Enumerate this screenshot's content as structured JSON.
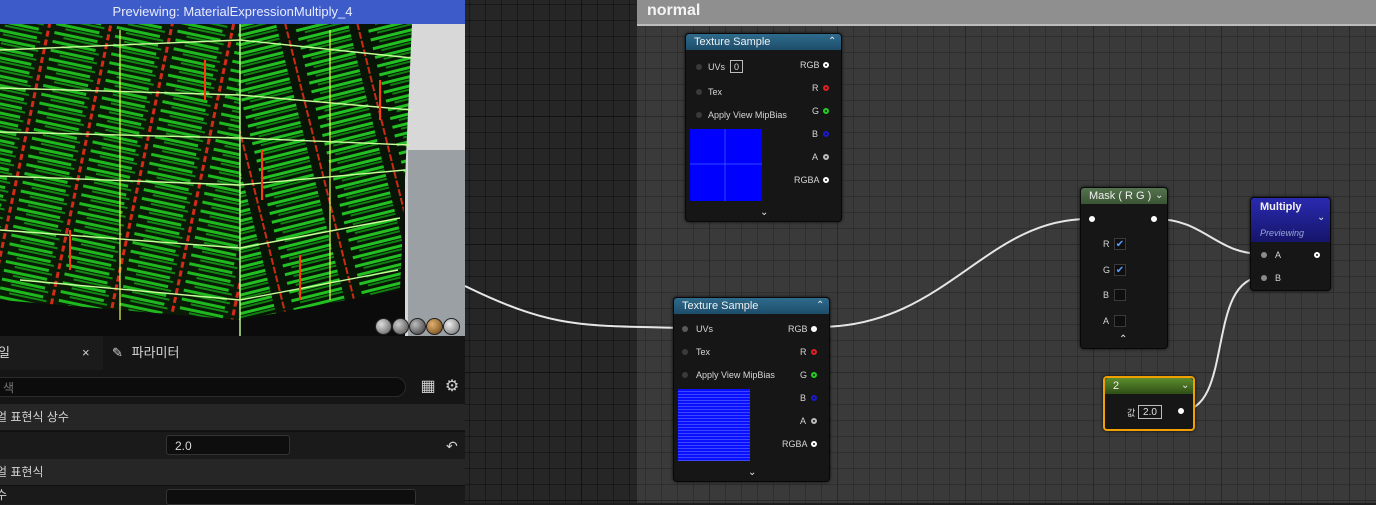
{
  "preview": {
    "title": "Previewing: MaterialExpressionMultiply_4",
    "viewport_icons": [
      "sphere-preview-icon",
      "cylinder-preview-icon",
      "plane-preview-icon",
      "cube-preview-icon",
      "teapot-preview-icon"
    ]
  },
  "details": {
    "tabs": [
      {
        "label": "일",
        "close": "×"
      },
      {
        "label": "파라미터"
      }
    ],
    "search_placeholder": "색",
    "categories": [
      {
        "label": "얼 표현식 상수"
      },
      {
        "label": "얼 표현식"
      }
    ],
    "rows": [
      {
        "label": "",
        "value": "2.0",
        "reset": "↶"
      },
      {
        "label": "수",
        "value": ""
      }
    ]
  },
  "graph": {
    "comment": "normal",
    "nodes": {
      "texture_sample_1": {
        "title": "Texture Sample",
        "inputs": [
          "UVs",
          "Tex",
          "Apply View MipBias"
        ],
        "uv_value": "0",
        "outputs": [
          "RGB",
          "R",
          "G",
          "B",
          "A",
          "RGBA"
        ]
      },
      "texture_sample_2": {
        "title": "Texture Sample",
        "inputs": [
          "UVs",
          "Tex",
          "Apply View MipBias"
        ],
        "outputs": [
          "RGB",
          "R",
          "G",
          "B",
          "A",
          "RGBA"
        ]
      },
      "mask": {
        "title": "Mask ( R G )",
        "channels": [
          {
            "label": "R",
            "checked": true
          },
          {
            "label": "G",
            "checked": true
          },
          {
            "label": "B",
            "checked": false
          },
          {
            "label": "A",
            "checked": false
          }
        ]
      },
      "multiply": {
        "title": "Multiply",
        "subtitle": "Previewing",
        "inputs": [
          "A",
          "B"
        ]
      },
      "constant": {
        "title": "2",
        "field_label": "값",
        "value": "2.0"
      }
    }
  },
  "colors": {
    "preview_title_bar": "#3d5bc9",
    "node_title_texture": "#2e6b8c",
    "node_title_mask": "#55734f",
    "node_title_constant": "#5c8d2c",
    "multiply_header": "#1a1a8a",
    "selection_outline": "#f0a000",
    "texture_preview_blue": "#0000ff"
  }
}
